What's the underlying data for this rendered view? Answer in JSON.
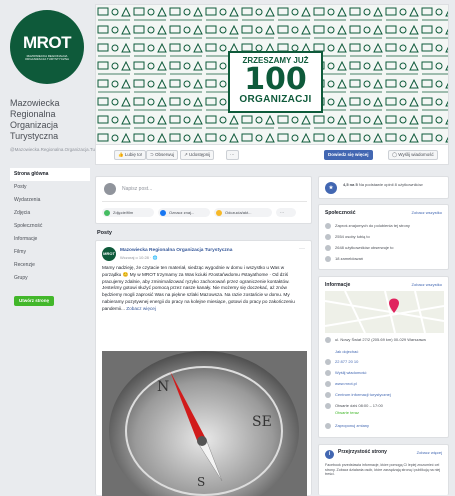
{
  "page": {
    "logo_text": "MROT",
    "logo_sub": "MAZOWIECKA REGIONALNA ORGANIZACJA TURYSTYCZNA",
    "name": "Mazowiecka Regionalna Organizacja Turystyczna",
    "handle": "@Mazowiecka.Regionalna.Organizacja.Turystyczna"
  },
  "nav": [
    "Strona główna",
    "Posty",
    "Wydarzenia",
    "Zdjęcia",
    "Społeczność",
    "Informacje",
    "Filmy",
    "Recenzje",
    "Grupy"
  ],
  "nav_cta": "Utwórz stronę",
  "cover": {
    "line1": "ZRZESZAMY JUŻ",
    "line2": "100",
    "line3": "ORGANIZACJI"
  },
  "actions": {
    "like": "Lubię to!",
    "follow": "Obserwuj",
    "share": "Udostępnij",
    "more": "···",
    "learn": "Dowiedz się więcej",
    "message": "Wyślij wiadomość"
  },
  "composer": {
    "placeholder": "Napisz post...",
    "photo": "Zdjęcie/film",
    "checkin": "Oznacz znaj...",
    "feeling": "Odczucia/akt...",
    "more": "···"
  },
  "feed": {
    "posts_label": "Posty",
    "post_author": "Mazowiecka Regionalna Organizacja Turystyczna",
    "post_date": "Wczoraj o 10:28 · ",
    "post_text": "Mamy nadzieję, że czytacie ten materiał, siedząc wygodnie w domu i wszystko u Was w porządku 😊 My w MROT trzymamy za Was kciuki #zostańwdomu #stayathome · Od dziś pracujemy zdalnie, aby zminimalizować ryzyko zachorowań przez ograniczenie kontaktów. Jesteśmy gotowi służyć pomocą przez nasze kanały. Nie możemy się doczekać, aż znów będziemy mogli zaprosić Was na piękne szlaki Mazowsza. Na razie zostańcie w domu. My nabieramy pozytywnej energii do pracy na kolejne miesiące, gotowi do pracy po zakończeniu pandemii...",
    "see_more": "Zobacz więcej"
  },
  "rating": {
    "value": "4,5 na 5",
    "text": "Na podstawie opinii 8 użytkowników"
  },
  "community": {
    "title": "Społeczność",
    "link": "Zobacz wszystko",
    "items": [
      "Zaproś znajomych do polubienia tej strony",
      "2554 osoby lubią to",
      "2648 użytkowników obserwuje to",
      "18 zameldowań"
    ]
  },
  "info": {
    "title": "Informacje",
    "link": "Zobacz wszystko",
    "address": "ul. Nowy Świat 27/2 (205.69 km) 00-029 Warszawa",
    "directions": "Jak dojechać",
    "phone": "22 877 20 10",
    "message": "Wyślij wiadomość",
    "website": "www.mrot.pl",
    "category": "Centrum informacji turystycznej",
    "hours": "Otwarte dziś 08:00 – 17:00",
    "hours_sub": "Otwarte teraz",
    "suggest": "Zaproponuj zmiany"
  },
  "transparency": {
    "title": "Przejrzystość strony",
    "link": "Zobacz więcej",
    "text": "Facebook przedstawia informacje, które pomogą Ci lepiej zrozumieć cel strony. Zobacz działania osób, które zarządzają stroną i publikują na niej treści."
  },
  "colors": {
    "brand": "#0e5a3a",
    "accent": "#4267b2",
    "cta": "#42b72a"
  }
}
